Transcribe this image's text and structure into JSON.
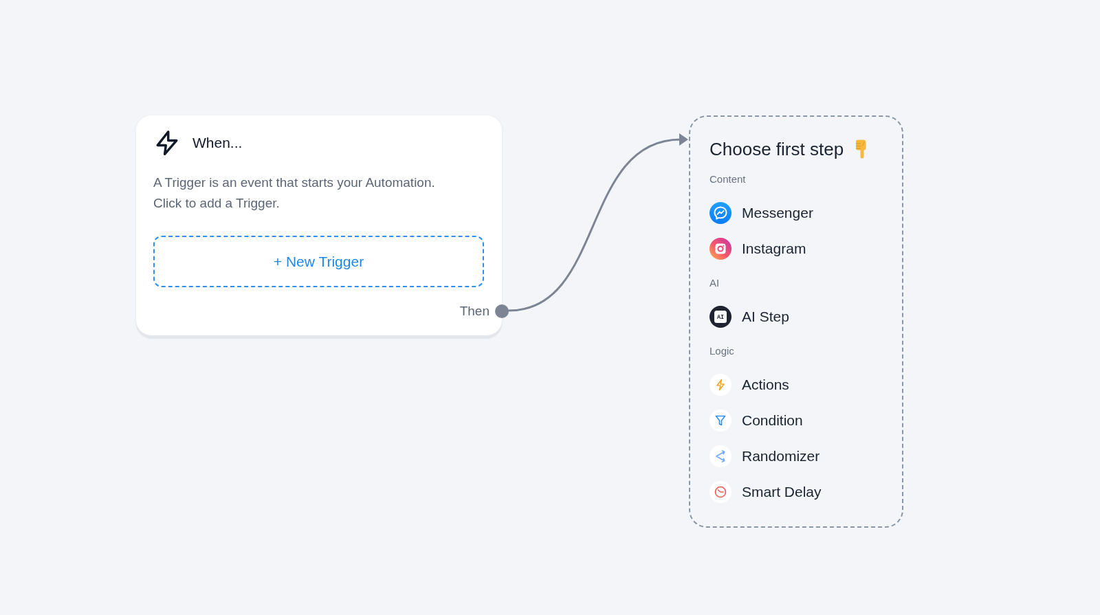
{
  "trigger_card": {
    "title": "When...",
    "description": "A Trigger is an event that starts your Automation. Click to add a Trigger.",
    "button": "+ New Trigger",
    "output_label": "Then"
  },
  "step_panel": {
    "title": "Choose first step",
    "groups": [
      {
        "label": "Content",
        "items": [
          {
            "label": "Messenger",
            "kind": "messenger"
          },
          {
            "label": "Instagram",
            "kind": "instagram"
          }
        ]
      },
      {
        "label": "AI",
        "items": [
          {
            "label": "AI Step",
            "kind": "ai",
            "icon_text": "AI"
          }
        ]
      },
      {
        "label": "Logic",
        "items": [
          {
            "label": "Actions",
            "kind": "actions"
          },
          {
            "label": "Condition",
            "kind": "condition"
          },
          {
            "label": "Randomizer",
            "kind": "randomizer"
          },
          {
            "label": "Smart Delay",
            "kind": "delay"
          }
        ]
      }
    ]
  }
}
